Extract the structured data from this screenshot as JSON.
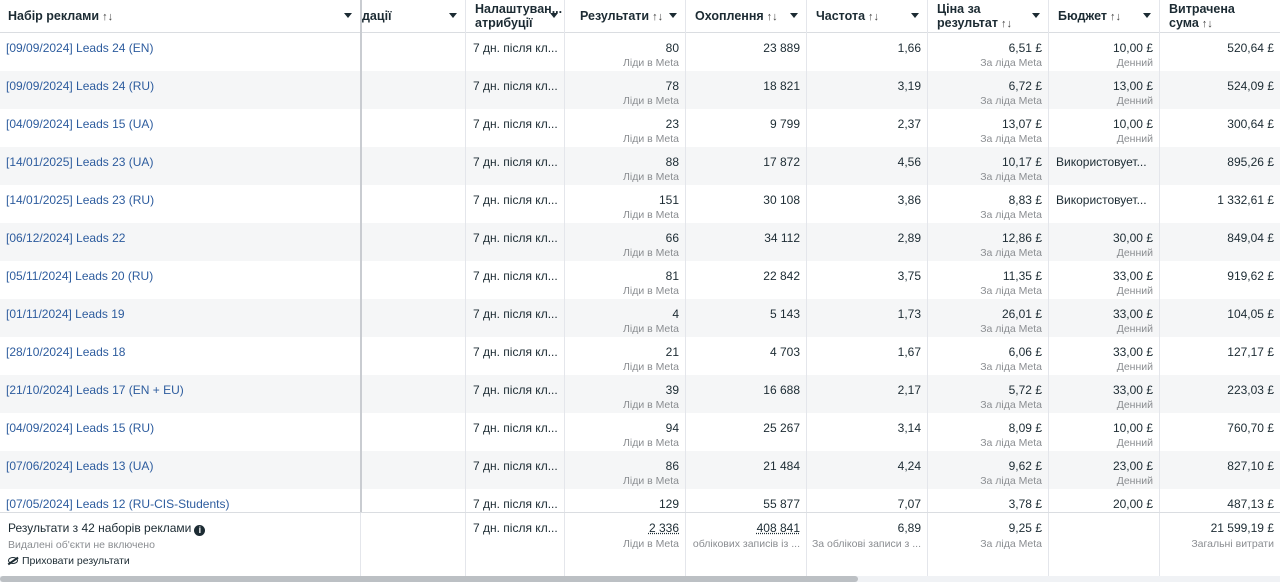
{
  "headers": {
    "name": "Набір реклами",
    "delivery": "дації",
    "attribution_line1": "Налаштуван...",
    "attribution_line2": "атрибуції",
    "results": "Результати",
    "reach": "Охоплення",
    "frequency": "Частота",
    "cpr_line1": "Ціна за",
    "cpr_line2": "результат",
    "budget": "Бюджет",
    "spend_line1": "Витрачена",
    "spend_line2": "сума",
    "sort_glyph": "↑↓"
  },
  "rows": [
    {
      "name": "[09/09/2024] Leads 24 (EN)",
      "attr": "7 дн. після кл...",
      "results": "80",
      "results_sub": "Ліди в Meta",
      "reach": "23 889",
      "frequency": "1,66",
      "cpr": "6,51 £",
      "cpr_sub": "За ліда Meta",
      "budget": "10,00 £",
      "budget_sub": "Денний",
      "spend": "520,64 £"
    },
    {
      "name": "[09/09/2024] Leads 24 (RU)",
      "attr": "7 дн. після кл...",
      "results": "78",
      "results_sub": "Ліди в Meta",
      "reach": "18 821",
      "frequency": "3,19",
      "cpr": "6,72 £",
      "cpr_sub": "За ліда Meta",
      "budget": "13,00 £",
      "budget_sub": "Денний",
      "spend": "524,09 £"
    },
    {
      "name": "[04/09/2024] Leads 15 (UA)",
      "attr": "7 дн. після кл...",
      "results": "23",
      "results_sub": "Ліди в Meta",
      "reach": "9 799",
      "frequency": "2,37",
      "cpr": "13,07 £",
      "cpr_sub": "За ліда Meta",
      "budget": "10,00 £",
      "budget_sub": "Денний",
      "spend": "300,64 £"
    },
    {
      "name": "[14/01/2025] Leads 23 (UA)",
      "attr": "7 дн. після кл...",
      "results": "88",
      "results_sub": "Ліди в Meta",
      "reach": "17 872",
      "frequency": "4,56",
      "cpr": "10,17 £",
      "cpr_sub": "За ліда Meta",
      "budget_text": "Використовует...",
      "spend": "895,26 £"
    },
    {
      "name": "[14/01/2025] Leads 23 (RU)",
      "attr": "7 дн. після кл...",
      "results": "151",
      "results_sub": "Ліди в Meta",
      "reach": "30 108",
      "frequency": "3,86",
      "cpr": "8,83 £",
      "cpr_sub": "За ліда Meta",
      "budget_text": "Використовует...",
      "spend": "1 332,61 £"
    },
    {
      "name": "[06/12/2024] Leads 22",
      "attr": "7 дн. після кл...",
      "results": "66",
      "results_sub": "Ліди в Meta",
      "reach": "34 112",
      "frequency": "2,89",
      "cpr": "12,86 £",
      "cpr_sub": "За ліда Meta",
      "budget": "30,00 £",
      "budget_sub": "Денний",
      "spend": "849,04 £"
    },
    {
      "name": "[05/11/2024] Leads 20 (RU)",
      "attr": "7 дн. після кл...",
      "results": "81",
      "results_sub": "Ліди в Meta",
      "reach": "22 842",
      "frequency": "3,75",
      "cpr": "11,35 £",
      "cpr_sub": "За ліда Meta",
      "budget": "33,00 £",
      "budget_sub": "Денний",
      "spend": "919,62 £"
    },
    {
      "name": "[01/11/2024] Leads 19",
      "attr": "7 дн. після кл...",
      "results": "4",
      "results_sub": "Ліди в Meta",
      "reach": "5 143",
      "frequency": "1,73",
      "cpr": "26,01 £",
      "cpr_sub": "За ліда Meta",
      "budget": "33,00 £",
      "budget_sub": "Денний",
      "spend": "104,05 £"
    },
    {
      "name": "[28/10/2024] Leads 18",
      "attr": "7 дн. після кл...",
      "results": "21",
      "results_sub": "Ліди в Meta",
      "reach": "4 703",
      "frequency": "1,67",
      "cpr": "6,06 £",
      "cpr_sub": "За ліда Meta",
      "budget": "33,00 £",
      "budget_sub": "Денний",
      "spend": "127,17 £"
    },
    {
      "name": "[21/10/2024] Leads 17 (EN + EU)",
      "attr": "7 дн. після кл...",
      "results": "39",
      "results_sub": "Ліди в Meta",
      "reach": "16 688",
      "frequency": "2,17",
      "cpr": "5,72 £",
      "cpr_sub": "За ліда Meta",
      "budget": "33,00 £",
      "budget_sub": "Денний",
      "spend": "223,03 £"
    },
    {
      "name": "[04/09/2024] Leads 15 (RU)",
      "attr": "7 дн. після кл...",
      "results": "94",
      "results_sub": "Ліди в Meta",
      "reach": "25 267",
      "frequency": "3,14",
      "cpr": "8,09 £",
      "cpr_sub": "За ліда Meta",
      "budget": "10,00 £",
      "budget_sub": "Денний",
      "spend": "760,70 £"
    },
    {
      "name": "[07/06/2024] Leads 13 (UA)",
      "attr": "7 дн. після кл...",
      "results": "86",
      "results_sub": "Ліди в Meta",
      "reach": "21 484",
      "frequency": "4,24",
      "cpr": "9,62 £",
      "cpr_sub": "За ліда Meta",
      "budget": "23,00 £",
      "budget_sub": "Денний",
      "spend": "827,10 £"
    },
    {
      "name": "[07/05/2024] Leads 12 (RU-CIS-Students)",
      "attr": "7 дн. після кл...",
      "results": "129",
      "results_sub": "",
      "reach": "55 877",
      "frequency": "7,07",
      "cpr": "3,78 £",
      "cpr_sub": "",
      "budget": "20,00 £",
      "budget_sub": "",
      "spend": "487,13 £"
    }
  ],
  "footer": {
    "title": "Результати з 42 наборів реклами",
    "info_icon": "i",
    "deleted_note": "Видалені об'єкти не включено",
    "hide_results": "Приховати результати",
    "attr": "7 дн. після кл...",
    "results": "2 336",
    "results_sub": "Ліди в Meta",
    "reach": "408 841",
    "reach_sub": "облікових записів із ...",
    "frequency": "6,89",
    "frequency_sub": "За облікові записи з ...",
    "cpr": "9,25 £",
    "cpr_sub": "За ліда Meta",
    "spend": "21 599,19 £",
    "spend_sub": "Загальні витрати"
  },
  "scroll": {
    "horizontal_position": 0.0,
    "visible_fraction": 0.67
  }
}
